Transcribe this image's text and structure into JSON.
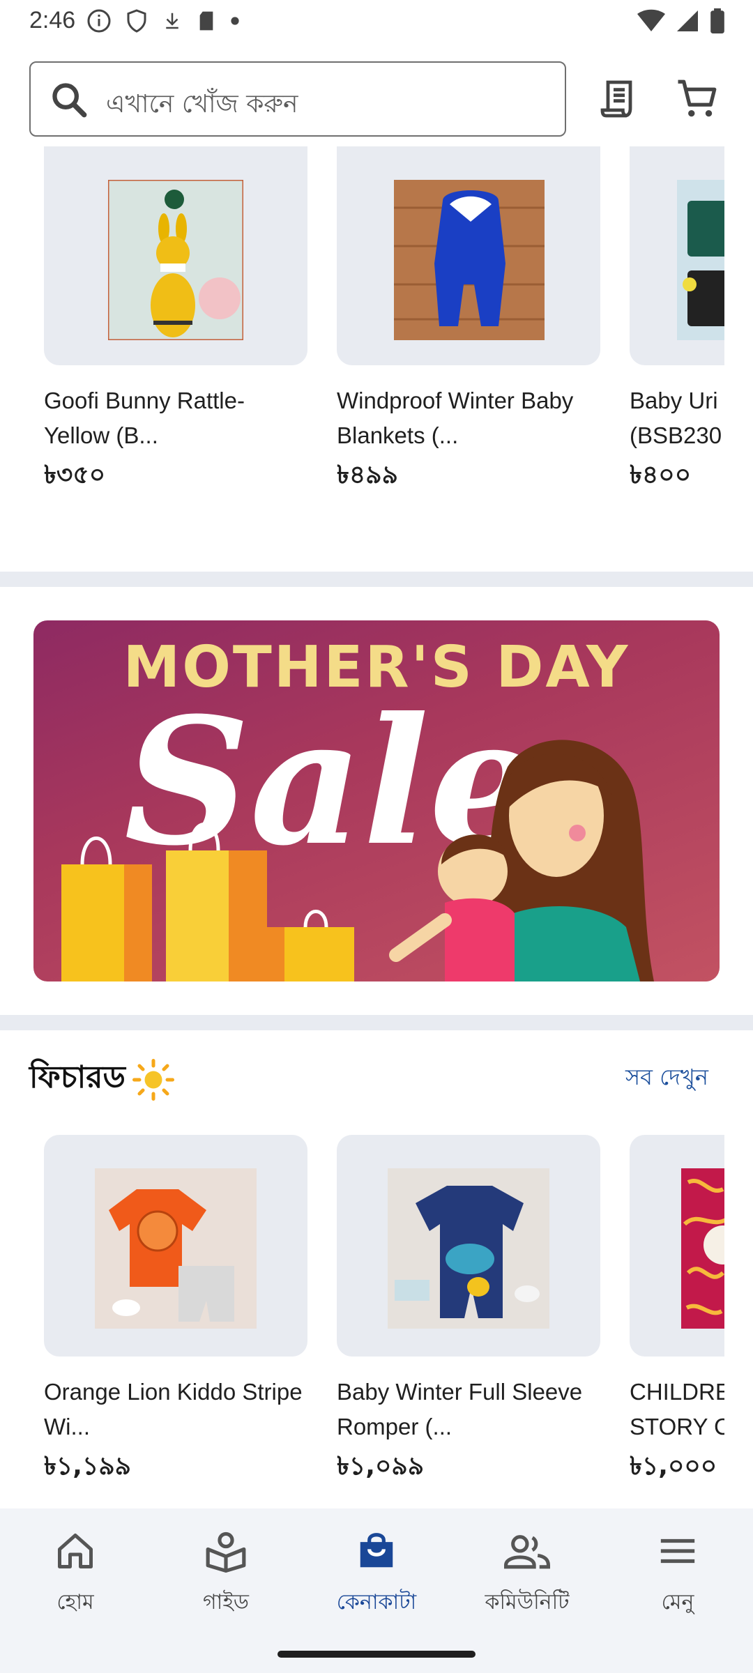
{
  "status_bar": {
    "time": "2:46"
  },
  "header": {
    "search_placeholder": "এখানে খোঁজ করুন"
  },
  "top_products": [
    {
      "name": "Goofi Bunny Rattle- Yellow (B...",
      "price": "৳৩৫০"
    },
    {
      "name": "Windproof Winter Baby Blankets (...",
      "price": "৳৪৯৯"
    },
    {
      "name": "Baby Uri (BSB230",
      "price": "৳৪০০"
    }
  ],
  "banner": {
    "subtitle": "MOTHER'S DAY",
    "title": "Sale"
  },
  "featured": {
    "title": "ফিচারড",
    "see_all": "সব দেখুন",
    "products": [
      {
        "name": "Orange Lion Kiddo Stripe Wi...",
        "price": "৳১,১৯৯"
      },
      {
        "name": "Baby Winter Full Sleeve Romper (...",
        "price": "৳১,০৯৯"
      },
      {
        "name": "CHILDRE STORY C",
        "price": "৳১,০০০"
      }
    ]
  },
  "bottom_nav": [
    {
      "label": "হোম",
      "icon": "home-icon"
    },
    {
      "label": "গাইড",
      "icon": "guide-icon"
    },
    {
      "label": "কেনাকাটা",
      "icon": "shopping-bag-icon",
      "active": true
    },
    {
      "label": "কমিউনিটি",
      "icon": "community-icon"
    },
    {
      "label": "মেনু",
      "icon": "menu-icon"
    }
  ],
  "colors": {
    "accent": "#1a4797",
    "card_bg": "#e8ebf1",
    "link": "#1c4f9c"
  }
}
